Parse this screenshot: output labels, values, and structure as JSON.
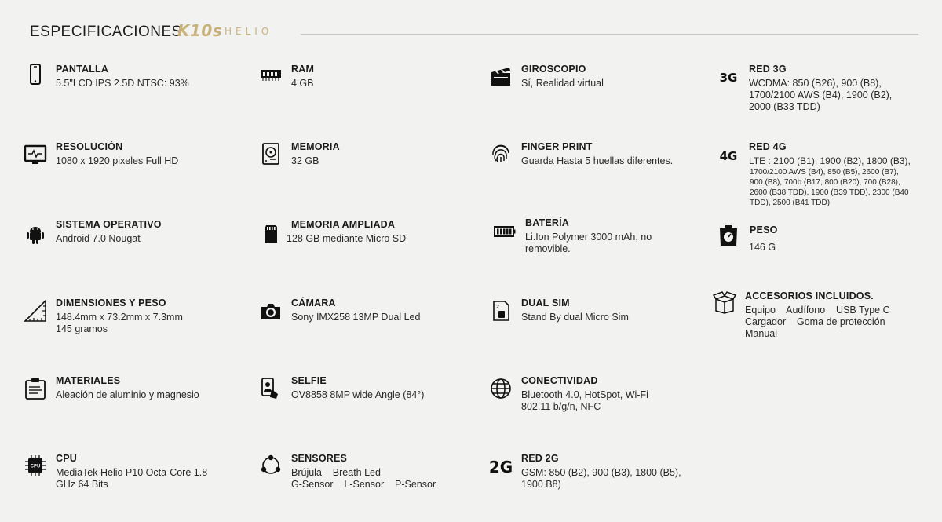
{
  "header": {
    "title": "ESPECIFICACIONES",
    "brand": "K10s",
    "brand_sub": "HELIO",
    "accent_color": "#c9b27a"
  },
  "specs": {
    "pantalla": {
      "label": "PANTALLA",
      "value": "5.5\"LCD IPS 2.5D NTSC: 93%",
      "icon": "smartphone-icon"
    },
    "resolucion": {
      "label": "RESOLUCIÓN",
      "value": "1080 x 1920 pixeles Full HD",
      "icon": "monitor-icon"
    },
    "sistema": {
      "label": "SISTEMA OPERATIVO",
      "value": "Android 7.0 Nougat",
      "icon": "android-icon"
    },
    "dimensiones": {
      "label": "DIMENSIONES Y PESO",
      "value1": "148.4mm x 73.2mm x 7.3mm",
      "value2": "145 gramos",
      "icon": "ruler-icon"
    },
    "materiales": {
      "label": "MATERIALES",
      "value": "Aleación de aluminio y magnesio",
      "icon": "clipboard-icon"
    },
    "cpu": {
      "label": "CPU",
      "value1": "MediaTek Helio P10 Octa-Core 1.8",
      "value2": "GHz 64 Bits",
      "icon": "cpu-icon",
      "icon_text": "CPU"
    },
    "ram": {
      "label": "RAM",
      "value": "4 GB",
      "icon": "ram-icon"
    },
    "memoria": {
      "label": "MEMORIA",
      "value": "32 GB",
      "icon": "hard-drive-icon"
    },
    "memoria_ampliada": {
      "label": "MEMORIA AMPLIADA",
      "value": "128 GB mediante Micro SD",
      "icon": "sd-card-icon"
    },
    "camara": {
      "label": "CÁMARA",
      "value": "Sony IMX258 13MP Dual Led",
      "icon": "camera-icon"
    },
    "selfie": {
      "label": "SELFIE",
      "value": "OV8858 8MP wide Angle (84°)",
      "icon": "selfie-icon"
    },
    "sensores": {
      "label": "SENSORES",
      "value1": "Brújula    Breath Led",
      "value2": "G-Sensor    L-Sensor    P-Sensor",
      "icon": "sensors-icon"
    },
    "giroscopio": {
      "label": "GIROSCOPIO",
      "value": "Sí, Realidad virtual",
      "icon": "clapperboard-icon"
    },
    "finger": {
      "label": "FINGER PRINT",
      "value": "Guarda Hasta 5 huellas diferentes.",
      "icon": "fingerprint-icon"
    },
    "bateria": {
      "label": "BATERÍA",
      "value1": "Li.Ion Polymer 3000 mAh, no",
      "value2": "removible.",
      "icon": "battery-icon"
    },
    "dualsim": {
      "label": "DUAL SIM",
      "value": "Stand By dual Micro Sim",
      "icon": "sim-card-icon"
    },
    "conectividad": {
      "label": "CONECTIVIDAD",
      "value1": "Bluetooth 4.0, HotSpot, Wi-Fi",
      "value2": "802.11 b/g/n, NFC",
      "icon": "globe-icon"
    },
    "red2g": {
      "label": "RED 2G",
      "value1": "GSM: 850 (B2), 900 (B3), 1800 (B5),",
      "value2": "1900 B8)",
      "icon": "2g-icon",
      "icon_text": "2G"
    },
    "red3g": {
      "label": "RED 3G",
      "value1": "WCDMA: 850 (B26), 900 (B8),",
      "value2": "1700/2100 AWS (B4), 1900 (B2),",
      "value3": "2000 (B33 TDD)",
      "icon": "3g-icon",
      "icon_text": "3G"
    },
    "red4g": {
      "label": "RED 4G",
      "value1": "LTE : 2100 (B1), 1900 (B2), 1800 (B3),",
      "value2": "1700/2100 AWS (B4), 850 (B5), 2600 (B7),",
      "value3": "900 (B8), 700b (B17, 800 (B20), 700 (B28),",
      "value4": "2600 (B38 TDD), 1900 (B39 TDD), 2300 (B40",
      "value5": "TDD), 2500 (B41 TDD)",
      "icon": "4g-icon",
      "icon_text": "4G"
    },
    "peso": {
      "label": "PESO",
      "value": "146 G",
      "icon": "scale-icon"
    },
    "accesorios": {
      "label": "ACCESORIOS INCLUIDOS.",
      "value1": "Equipo    Audífono    USB Type C",
      "value2": "Cargador    Goma de protección",
      "value3": "Manual",
      "icon": "box-icon"
    }
  }
}
